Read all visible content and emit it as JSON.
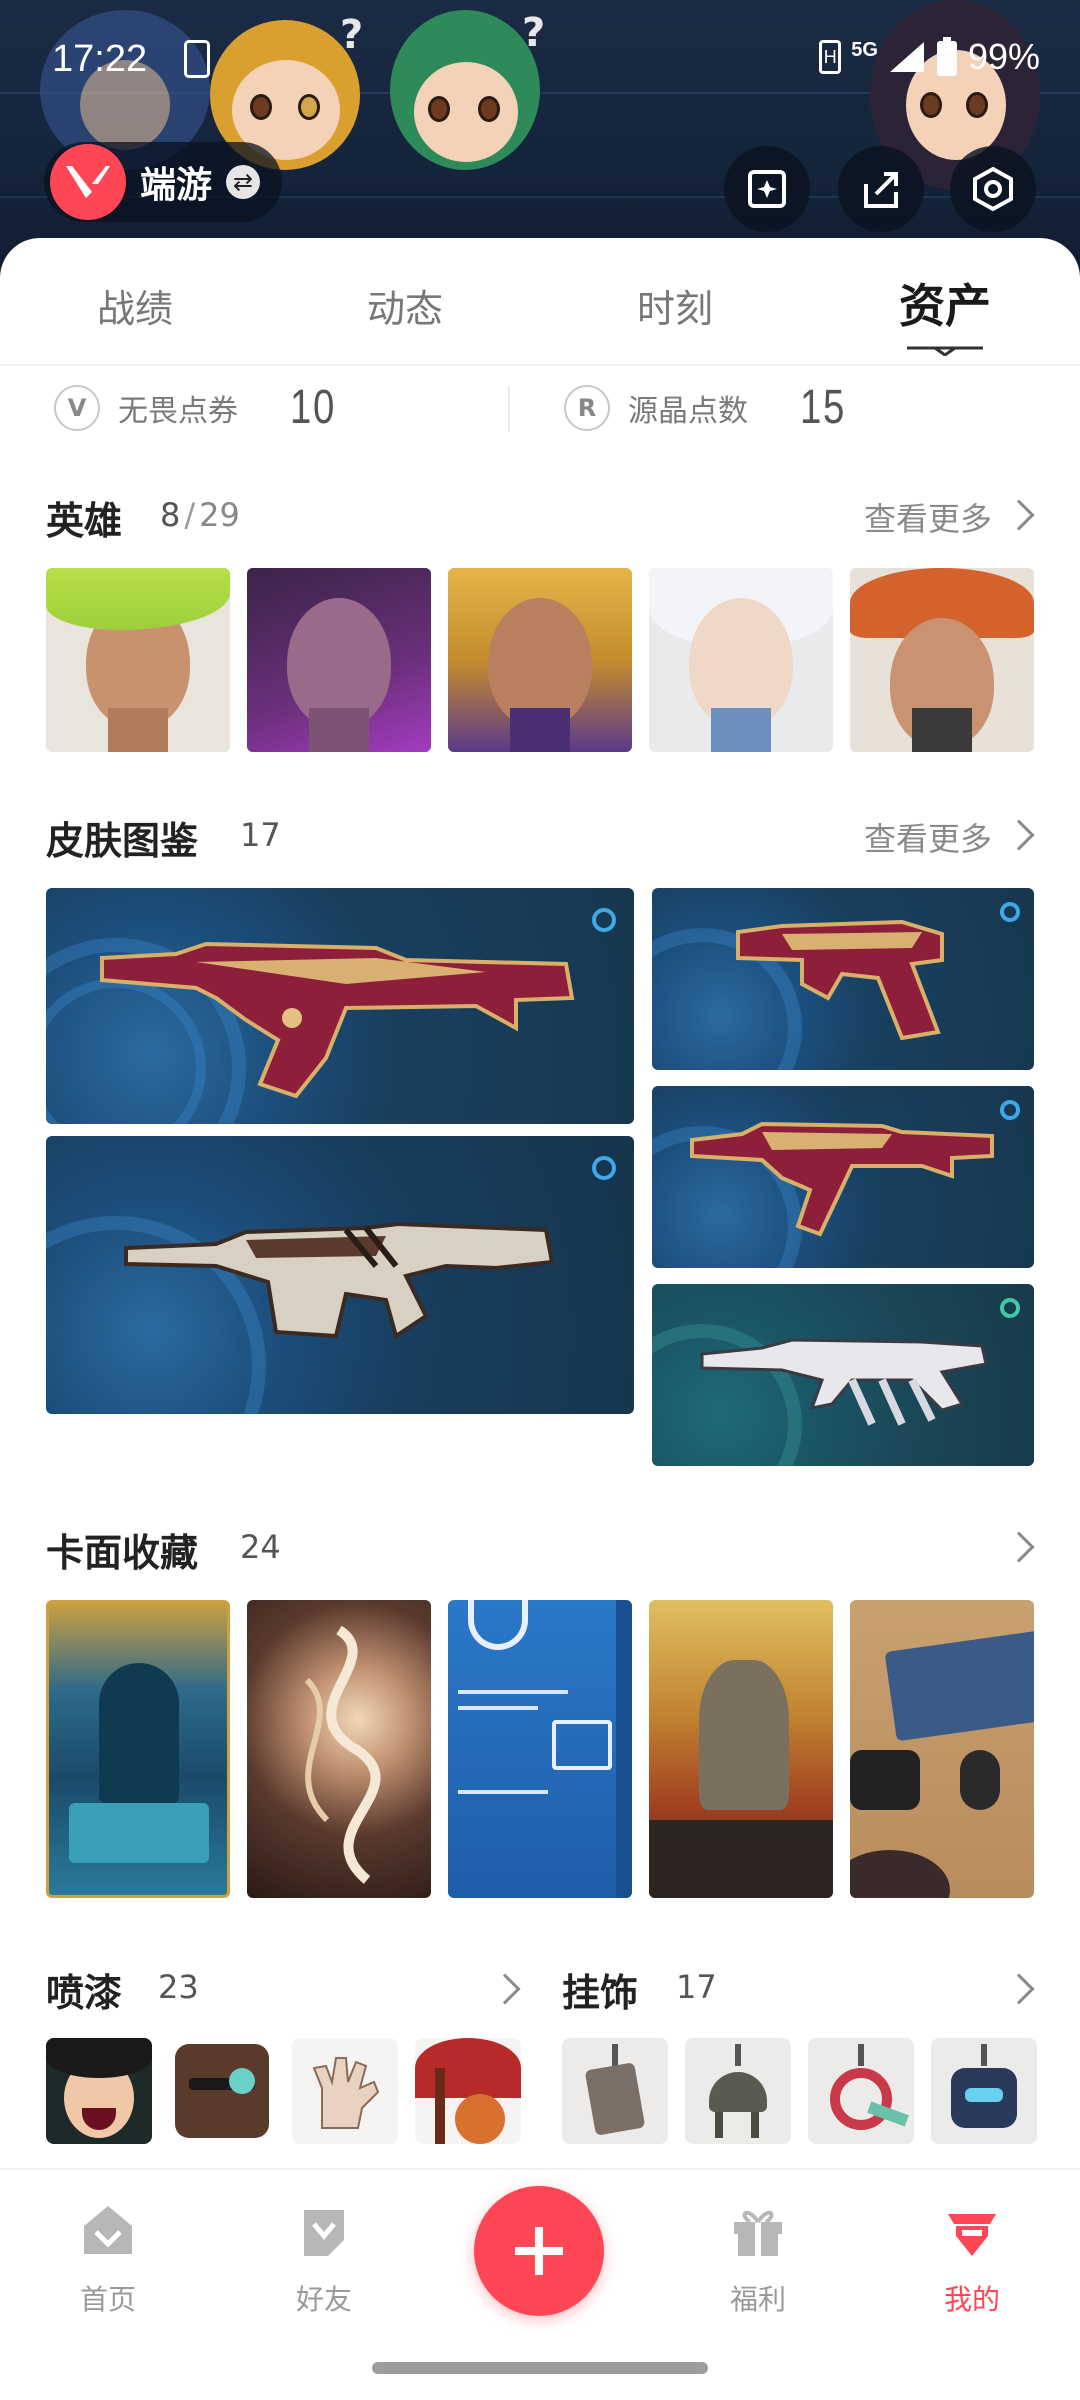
{
  "status_bar": {
    "time": "17:22",
    "network": "5G",
    "battery": "99%"
  },
  "header": {
    "profile_name": "端游",
    "icons": [
      "valorant-logo-icon",
      "swap-icon",
      "ai-card-icon",
      "share-icon",
      "settings-icon"
    ],
    "colors": {
      "brand": "#ff4655",
      "banner": "#16263e"
    }
  },
  "tabs": [
    {
      "label": "战绩",
      "active": false
    },
    {
      "label": "动态",
      "active": false
    },
    {
      "label": "时刻",
      "active": false
    },
    {
      "label": "资产",
      "active": true
    }
  ],
  "points": {
    "vp": {
      "label": "无畏点券",
      "value": "10",
      "icon": "vp-coin-icon"
    },
    "rp": {
      "label": "源晶点数",
      "value": "15",
      "icon": "radianite-icon"
    }
  },
  "agents": {
    "title": "英雄",
    "owned": "8",
    "sep": "/",
    "total": "29",
    "more": "查看更多",
    "items": [
      "agent-portrait-1",
      "agent-portrait-2",
      "agent-portrait-3",
      "agent-portrait-4",
      "agent-portrait-5"
    ]
  },
  "skins": {
    "title": "皮肤图鉴",
    "count": "17",
    "more": "查看更多",
    "items": [
      "vandal-skin",
      "phantom-skin",
      "ghost-skin",
      "spectre-skin",
      "odin-skin"
    ]
  },
  "cards": {
    "title": "卡面收藏",
    "count": "24",
    "items": [
      "player-card-1",
      "player-card-2",
      "player-card-3",
      "player-card-4",
      "player-card-5"
    ]
  },
  "sprays": {
    "title": "喷漆",
    "count": "23",
    "items": [
      "spray-1",
      "spray-2",
      "spray-3",
      "spray-4"
    ]
  },
  "charms": {
    "title": "挂饰",
    "count": "17",
    "items": [
      "buddy-1",
      "buddy-2",
      "buddy-3",
      "buddy-4"
    ]
  },
  "bottom_nav": {
    "home": "首页",
    "friends": "好友",
    "post_icon": "plus-icon",
    "welfare": "福利",
    "me": "我的",
    "active_color": "#ff4655",
    "inactive_color": "#9a9a9a"
  }
}
